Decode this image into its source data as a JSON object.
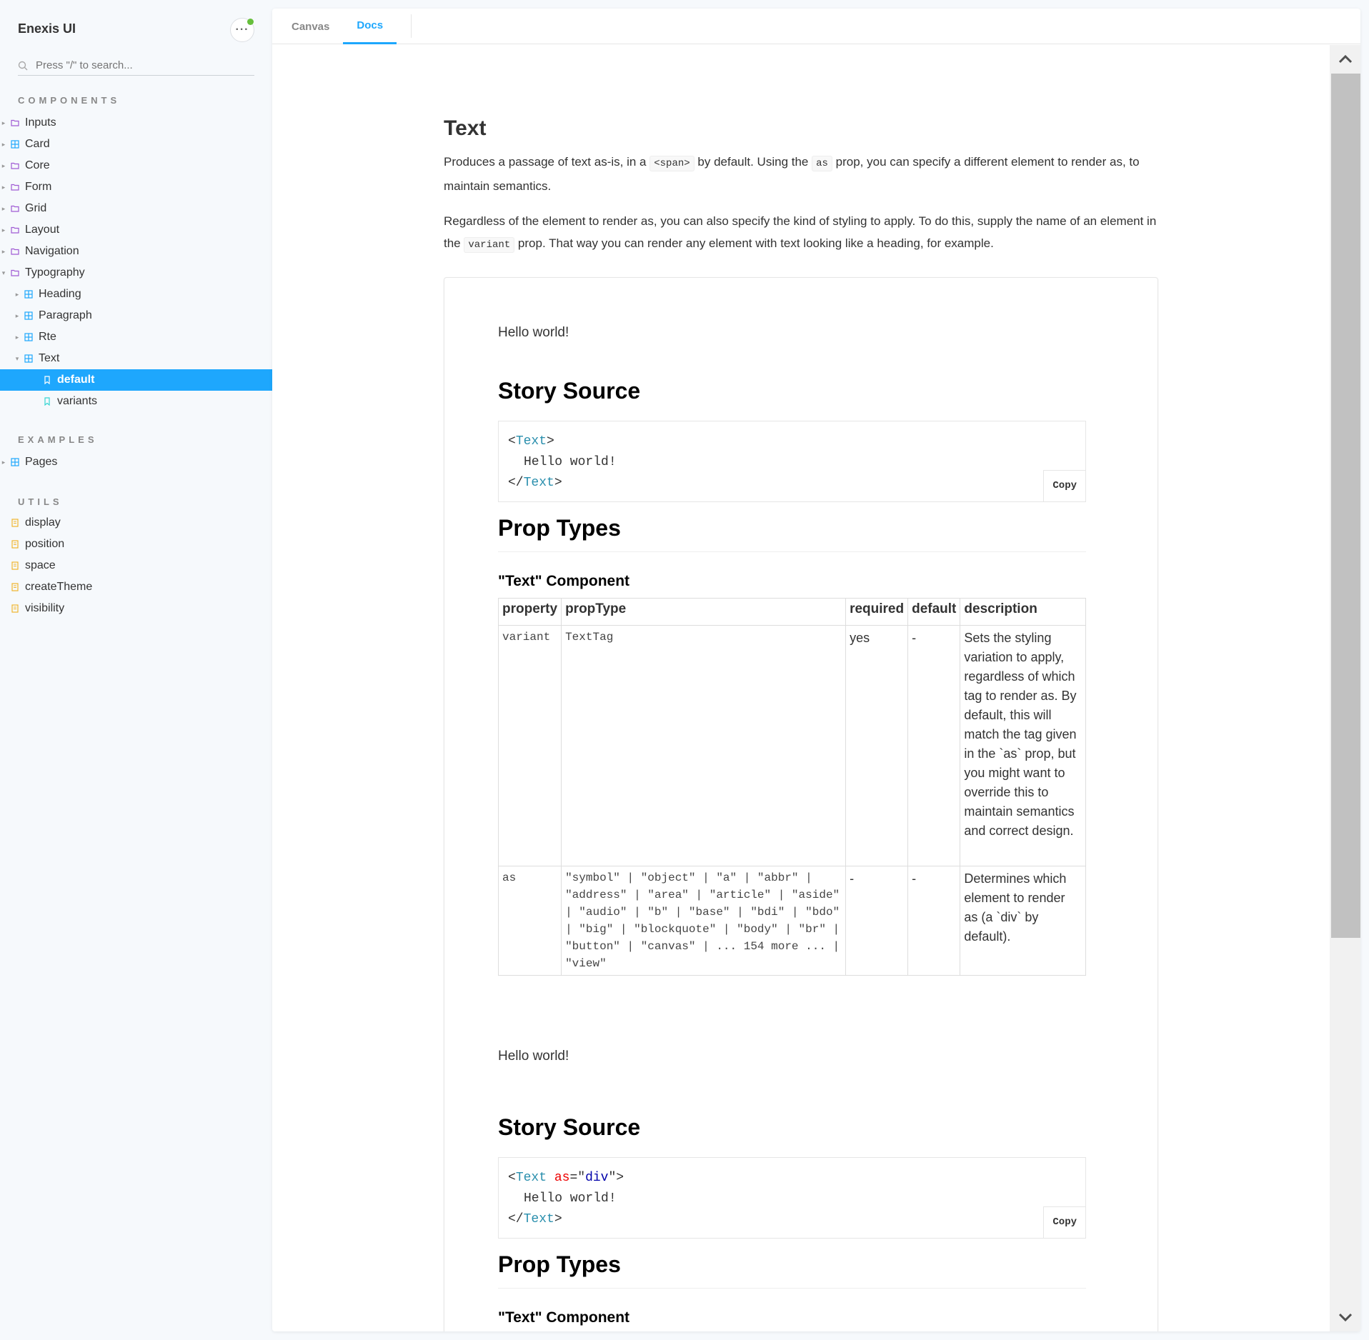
{
  "sidebar": {
    "brand": "Enexis UI",
    "search_placeholder": "Press \"/\" to search...",
    "sections": {
      "components": "COMPONENTS",
      "examples": "EXAMPLES",
      "utils": "UTILS"
    },
    "components": [
      "Inputs",
      "Card",
      "Core",
      "Form",
      "Grid",
      "Layout",
      "Navigation",
      "Typography"
    ],
    "typography_children": [
      "Heading",
      "Paragraph",
      "Rte",
      "Text"
    ],
    "text_stories": [
      "default",
      "variants"
    ],
    "examples": [
      "Pages"
    ],
    "utils": [
      "display",
      "position",
      "space",
      "createTheme",
      "visibility"
    ]
  },
  "tabs": [
    "Canvas",
    "Docs"
  ],
  "docs": {
    "title": "Text",
    "intro": {
      "part1": "Produces a passage of text as-is, in a",
      "code1": "<span>",
      "part2": "by default. Using the",
      "code2": "as",
      "part3": "prop, you can specify a different element to render as, to maintain semantics."
    },
    "intro2": {
      "part1": "Regardless of the element to render as, you can also specify the kind of styling to apply. To do this, supply the name of an element in the",
      "code1": "variant",
      "part2": "prop. That way you can render any element with text looking like a heading, for example."
    },
    "stories": [
      {
        "hello": "Hello world!",
        "story_source_heading": "Story Source",
        "code": {
          "open_lt": "<",
          "tag": "Text",
          "gt": ">",
          "body": "Hello world!",
          "close_lt": "</"
        },
        "copy": "Copy",
        "prop_types_heading": "Prop Types",
        "component_heading": "\"Text\" Component",
        "table": {
          "headers": [
            "property",
            "propType",
            "required",
            "default",
            "description"
          ],
          "rows": [
            {
              "property": "variant",
              "propType": "TextTag",
              "required": "yes",
              "default": "-",
              "description": "Sets the styling variation to apply, regardless of which tag to render as. By default, this will match the tag given in the `as` prop, but you might want to override this to maintain semantics and correct design."
            },
            {
              "property": "as",
              "propType": "\"symbol\" | \"object\" | \"a\" | \"abbr\" | \"address\" | \"area\" | \"article\" | \"aside\" | \"audio\" | \"b\" | \"base\" | \"bdi\" | \"bdo\" | \"big\" | \"blockquote\" | \"body\" | \"br\" | \"button\" | \"canvas\" | ... 154 more ... | \"view\"",
              "required": "-",
              "default": "-",
              "description": "Determines which element to render as (a `div` by default)."
            }
          ]
        }
      },
      {
        "hello": "Hello world!",
        "story_source_heading": "Story Source",
        "code": {
          "open_lt": "<",
          "tag": "Text",
          "attr": "as",
          "eq": "=\"",
          "val": "div",
          "endq": "\">",
          "body": "Hello world!",
          "close_lt": "</",
          "gt": ">"
        },
        "copy": "Copy",
        "prop_types_heading": "Prop Types",
        "component_heading": "\"Text\" Component"
      }
    ]
  },
  "colors": {
    "accent": "#1ea7fd",
    "folder_icon": "#a05bd4",
    "component_icon": "#1ea7fd",
    "story_icon": "#1ea7fd",
    "doc_icon": "#f1b62d",
    "online_dot": "#66bf3c"
  }
}
